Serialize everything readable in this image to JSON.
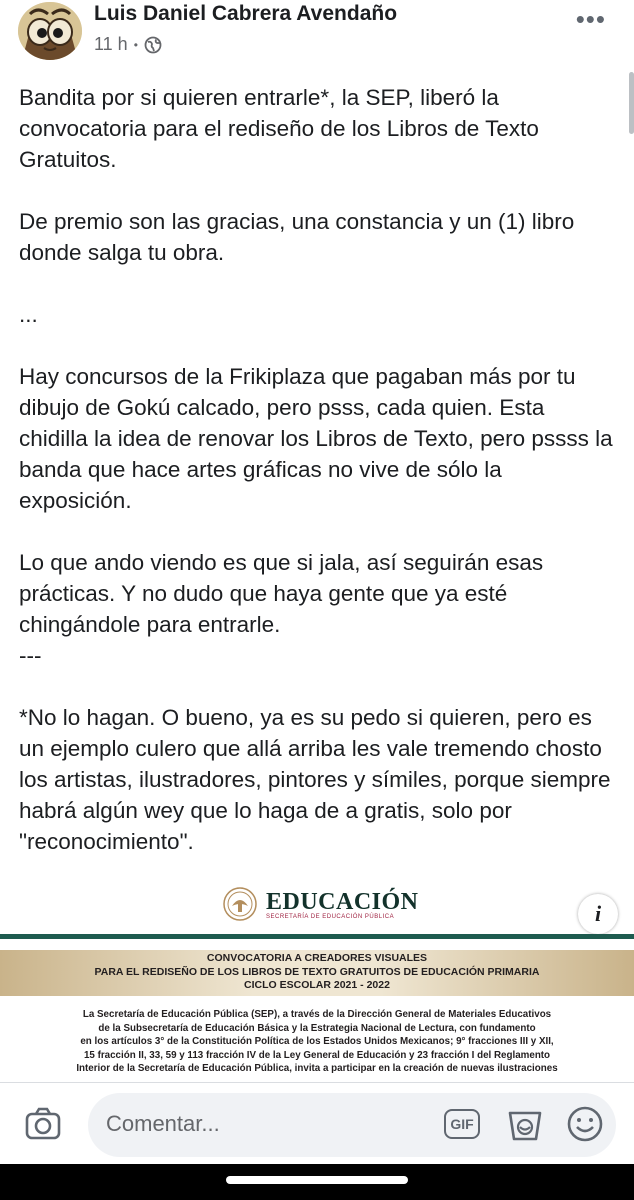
{
  "post": {
    "author": "Luis Daniel Cabrera Avendaño",
    "time": "11 h",
    "separator": "•",
    "visibility_icon": "globe-icon",
    "more_icon": "more-dots-icon",
    "paragraphs": [
      "Bandita por si quieren entrarle*, la SEP, liberó la convocatoria para el rediseño de los Libros de Texto Gratuitos.",
      "De premio son las gracias, una constancia y un (1) libro donde salga tu obra.",
      "...",
      "Hay concursos de la Frikiplaza que pagaban más por tu dibujo de Gokú calcado, pero psss, cada quien. Esta chidilla la idea de renovar los Libros de Texto, pero pssss la banda que hace artes gráficas no vive de sólo la exposición.",
      "Lo que ando viendo es que si jala, así seguirán esas prácticas. Y no dudo que haya gente que ya esté chingándole para entrarle.\n---",
      "*No lo hagan. O bueno, ya es su pedo si quieren, pero es un ejemplo culero que allá arriba les vale tremendo chosto los artistas, ilustradores, pintores y símiles, porque siempre habrá algún wey que lo haga de a gratis, solo por \"reconocimiento\"."
    ]
  },
  "image": {
    "logo_title": "EDUCACIÓN",
    "logo_subtitle": "SECRETARÍA DE EDUCACIÓN PÚBLICA",
    "info_label": "i",
    "title_lines": [
      "CONVOCATORIA A CREADORES VISUALES",
      "PARA EL REDISEÑO DE LOS LIBROS DE TEXTO GRATUITOS DE EDUCACIÓN PRIMARIA",
      "CICLO ESCOLAR 2021 - 2022"
    ],
    "body_lines": [
      "La Secretaría de Educación Pública (SEP), a través de la Dirección General de Materiales Educativos",
      "de la Subsecretaría de Educación Básica y la Estrategia Nacional de Lectura, con fundamento",
      "en los artículos 3° de la Constitución Política de los Estados Unidos Mexicanos; 9° fracciones III y XII,",
      "15 fracción II, 33, 59 y 113 fracción IV de la Ley General de Educación y 23 fracción I del Reglamento",
      "Interior de la Secretaría de Educación Pública, invita a participar en la creación de nuevas ilustraciones"
    ],
    "colors": {
      "green": "#1e5b4f",
      "gold": "#c9b38a",
      "maroon": "#9f2241"
    }
  },
  "comment_bar": {
    "placeholder": "Comentar...",
    "gif_label": "GIF",
    "camera_icon": "camera-icon",
    "sticker_icon": "sticker-icon",
    "emoji_icon": "emoji-icon"
  }
}
